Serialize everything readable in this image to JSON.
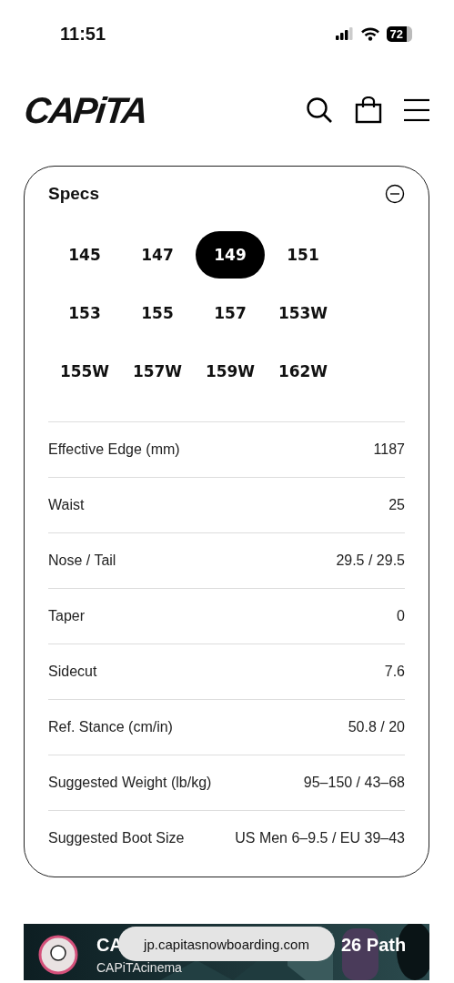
{
  "status_bar": {
    "time": "11:51",
    "battery": "72"
  },
  "header": {
    "logo": "CAPiTA"
  },
  "specs": {
    "title": "Specs",
    "expanded": true,
    "sizes": [
      {
        "label": "145",
        "selected": false
      },
      {
        "label": "147",
        "selected": false
      },
      {
        "label": "149",
        "selected": true
      },
      {
        "label": "151",
        "selected": false
      },
      {
        "label": "153",
        "selected": false
      },
      {
        "label": "155",
        "selected": false
      },
      {
        "label": "157",
        "selected": false
      },
      {
        "label": "153W",
        "selected": false
      },
      {
        "label": "155W",
        "selected": false
      },
      {
        "label": "157W",
        "selected": false
      },
      {
        "label": "159W",
        "selected": false
      },
      {
        "label": "162W",
        "selected": false
      }
    ],
    "rows": [
      {
        "label": "Effective Edge (mm)",
        "value": "1187"
      },
      {
        "label": "Waist",
        "value": "25"
      },
      {
        "label": "Nose / Tail",
        "value": "29.5 / 29.5"
      },
      {
        "label": "Taper",
        "value": "0"
      },
      {
        "label": "Sidecut",
        "value": "7.6"
      },
      {
        "label": "Ref. Stance (cm/in)",
        "value": "50.8 / 20"
      },
      {
        "label": "Suggested Weight (lb/kg)",
        "value": "95–150 / 43–68"
      },
      {
        "label": "Suggested Boot Size",
        "value": "US Men 6–9.5 / EU 39–43"
      }
    ]
  },
  "video": {
    "title_start": "CA",
    "title_end": "26 Path",
    "channel": "CAPiTAcinema"
  },
  "url_bar": {
    "address": "jp.capitasnowboarding.com"
  }
}
